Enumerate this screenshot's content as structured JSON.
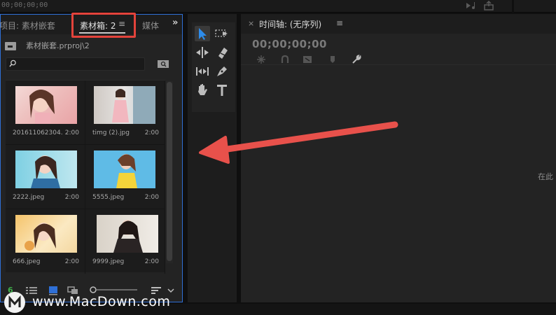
{
  "topbar": {
    "timecode": "00;00;00;00"
  },
  "bin_panel": {
    "tabs": [
      {
        "label": "项目: 素材嵌套"
      },
      {
        "label": "素材箱: 2"
      },
      {
        "label": "媒体"
      }
    ],
    "path": "素材嵌套.prproj\\2",
    "search": {
      "value": "",
      "placeholder": ""
    },
    "clips": [
      {
        "name": "201611062304...",
        "duration": "2:00"
      },
      {
        "name": "timg (2).jpg",
        "duration": "2:00"
      },
      {
        "name": "2222.jpeg",
        "duration": "2:00"
      },
      {
        "name": "5555.jpeg",
        "duration": "2:00"
      },
      {
        "name": "666.jpeg",
        "duration": "2:00"
      },
      {
        "name": "9999.jpeg",
        "duration": "2:00"
      }
    ],
    "bottom": {
      "count_badge": "6"
    }
  },
  "timeline": {
    "title": "时间轴: (无序列)",
    "timecode": "00;00;00;00",
    "hint": "在此"
  },
  "watermark": {
    "text": "www.MacDown.com"
  },
  "colors": {
    "accent_blue": "#2f6fd6",
    "highlight_red": "#e3433b",
    "annotation_arrow": "#e8514b"
  }
}
